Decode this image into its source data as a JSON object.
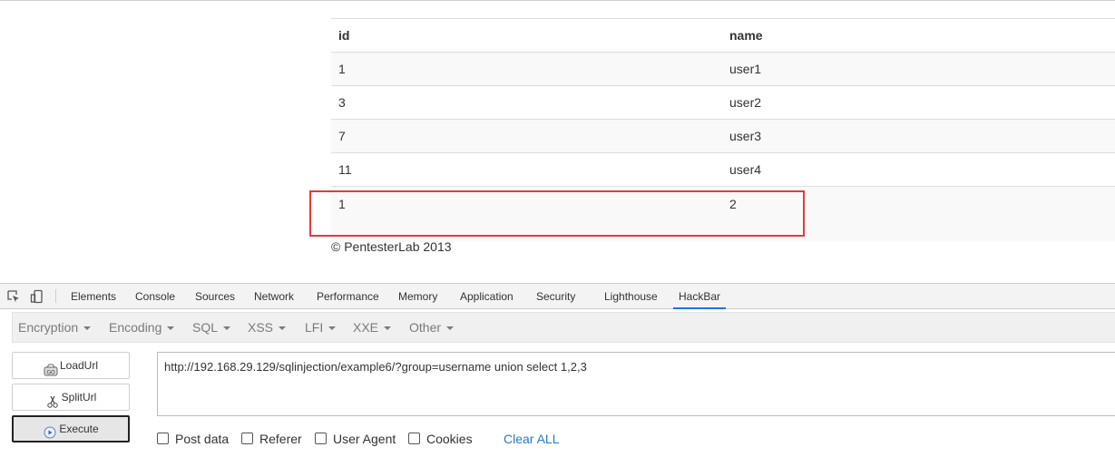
{
  "table": {
    "headers": [
      "id",
      "name"
    ],
    "rows": [
      [
        "1",
        "user1"
      ],
      [
        "3",
        "user2"
      ],
      [
        "7",
        "user3"
      ],
      [
        "11",
        "user4"
      ],
      [
        "1",
        "2"
      ]
    ]
  },
  "footer": "© PentesterLab 2013",
  "devtools": {
    "tabs": [
      "Elements",
      "Console",
      "Sources",
      "Network",
      "Performance",
      "Memory",
      "Application",
      "Security",
      "Lighthouse",
      "HackBar"
    ],
    "active_tab": "HackBar",
    "icons": [
      "inspect-element-icon",
      "device-toolbar-icon"
    ]
  },
  "hackbar": {
    "menus": [
      "Encryption",
      "Encoding",
      "SQL",
      "XSS",
      "LFI",
      "XXE",
      "Other"
    ],
    "buttons": {
      "load": "LoadUrl",
      "split": "SplitUrl",
      "execute": "Execute"
    },
    "url": "http://192.168.29.129/sqlinjection/example6/?group=username union select 1,2,3",
    "options": [
      "Post data",
      "Referer",
      "User Agent",
      "Cookies"
    ],
    "clear_all": "Clear ALL"
  },
  "colors": {
    "highlight": "#e23b3b",
    "active_tab_underline": "#1a73e8",
    "link": "#2a7ac0"
  }
}
